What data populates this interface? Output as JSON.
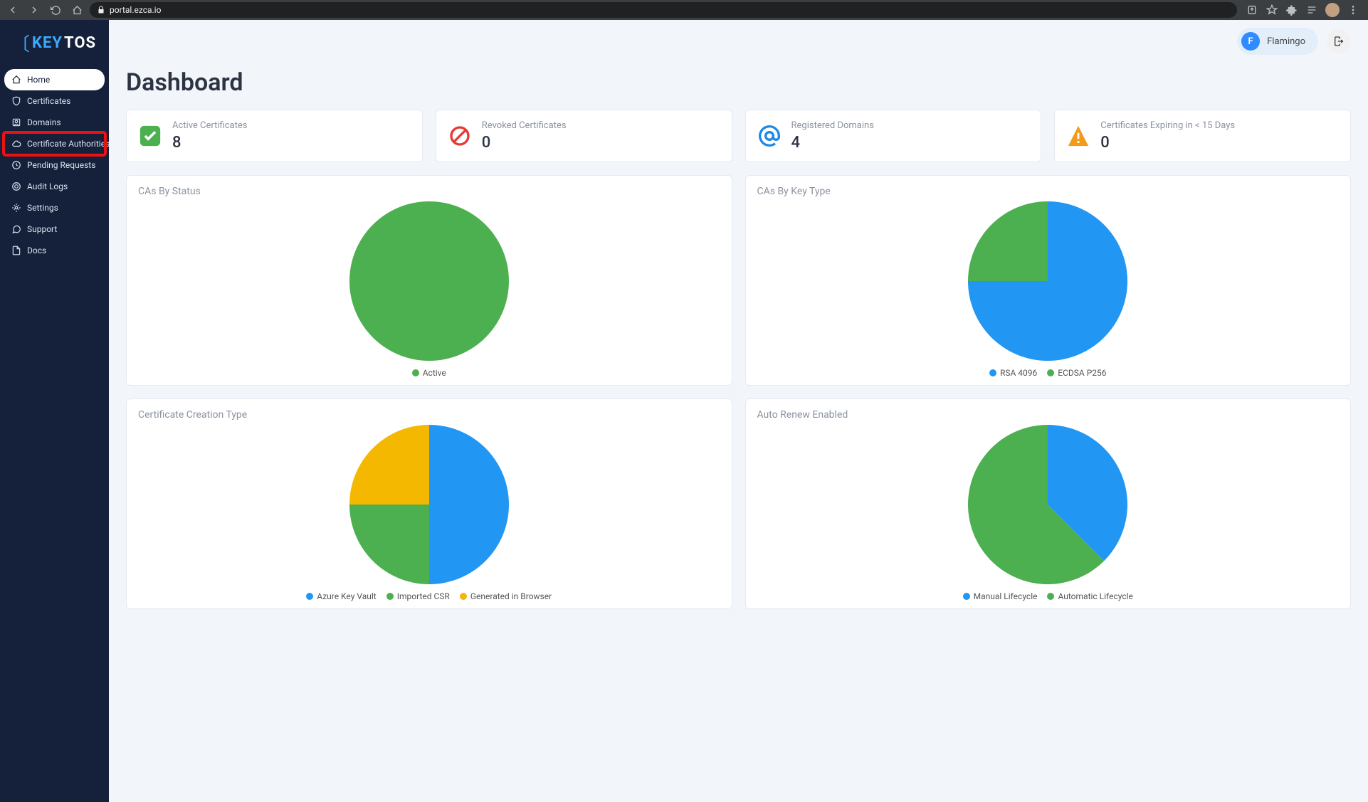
{
  "browser": {
    "url": "portal.ezca.io"
  },
  "brand": {
    "pre": "KEY",
    "post": "TOS"
  },
  "sidebar": {
    "items": [
      {
        "label": "Home",
        "icon": "home"
      },
      {
        "label": "Certificates",
        "icon": "shield"
      },
      {
        "label": "Domains",
        "icon": "id"
      },
      {
        "label": "Certificate Authorities",
        "icon": "cloud"
      },
      {
        "label": "Pending Requests",
        "icon": "clock"
      },
      {
        "label": "Audit Logs",
        "icon": "target"
      },
      {
        "label": "Settings",
        "icon": "gear"
      },
      {
        "label": "Support",
        "icon": "chat"
      },
      {
        "label": "Docs",
        "icon": "doc"
      }
    ]
  },
  "header": {
    "user_initial": "F",
    "user_name": "Flamingo"
  },
  "page": {
    "title": "Dashboard"
  },
  "stats": [
    {
      "label": "Active Certificates",
      "value": "8",
      "icon": "check",
      "color": "#4caf50"
    },
    {
      "label": "Revoked Certificates",
      "value": "0",
      "icon": "ban",
      "color": "#e53935"
    },
    {
      "label": "Registered Domains",
      "value": "4",
      "icon": "at",
      "color": "#1e88e5"
    },
    {
      "label": "Certificates Expiring in < 15 Days",
      "value": "0",
      "icon": "alert",
      "color": "#f29b1d"
    }
  ],
  "chart_data": [
    {
      "id": "cas-by-status",
      "type": "pie",
      "title": "CAs By Status",
      "series": [
        {
          "name": "Active",
          "value": 100,
          "color": "#4caf50"
        }
      ]
    },
    {
      "id": "cas-by-key-type",
      "type": "pie",
      "title": "CAs By Key Type",
      "series": [
        {
          "name": "RSA 4096",
          "value": 75,
          "color": "#2196f3"
        },
        {
          "name": "ECDSA P256",
          "value": 25,
          "color": "#4caf50"
        }
      ]
    },
    {
      "id": "cert-creation-type",
      "type": "pie",
      "title": "Certificate Creation Type",
      "series": [
        {
          "name": "Azure Key Vault",
          "value": 50,
          "color": "#2196f3"
        },
        {
          "name": "Imported CSR",
          "value": 25,
          "color": "#4caf50"
        },
        {
          "name": "Generated in Browser",
          "value": 25,
          "color": "#f5b800"
        }
      ]
    },
    {
      "id": "auto-renew-enabled",
      "type": "pie",
      "title": "Auto Renew Enabled",
      "series": [
        {
          "name": "Manual Lifecycle",
          "value": 37.5,
          "color": "#2196f3"
        },
        {
          "name": "Automatic Lifecycle",
          "value": 62.5,
          "color": "#4caf50"
        }
      ]
    }
  ]
}
